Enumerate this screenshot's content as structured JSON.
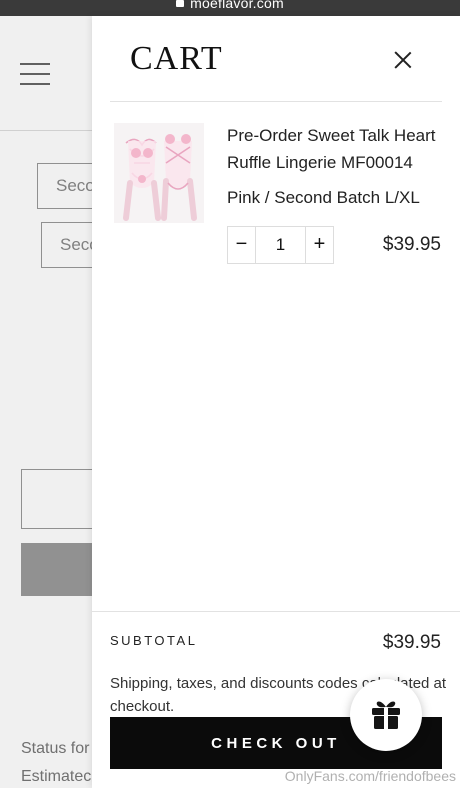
{
  "browser": {
    "url": "moeflavor.com",
    "lock_icon": "lock-icon"
  },
  "background_page": {
    "select_1": "Seco",
    "select_2": "Seco",
    "status_text": "Status for",
    "estimated_text": "Estimatec"
  },
  "cart": {
    "title": "CART",
    "close_icon": "close-icon",
    "item": {
      "name": "Pre-Order Sweet Talk Heart Ruffle Lingerie MF00014",
      "variant": "Pink / Second Batch L/XL",
      "quantity": "1",
      "price": "$39.95",
      "minus_label": "−",
      "plus_label": "+"
    },
    "subtotal_label": "SUBTOTAL",
    "subtotal_value": "$39.95",
    "shipping_note": "Shipping, taxes, and discounts codes calculated at checkout.",
    "checkout_label": "CHECK OUT"
  },
  "widgets": {
    "gift_icon": "gift-icon"
  },
  "watermark": "OnlyFans.com/friendofbees",
  "colors": {
    "checkout_bg": "#0b0b0b",
    "gift_icon": "#151515"
  }
}
